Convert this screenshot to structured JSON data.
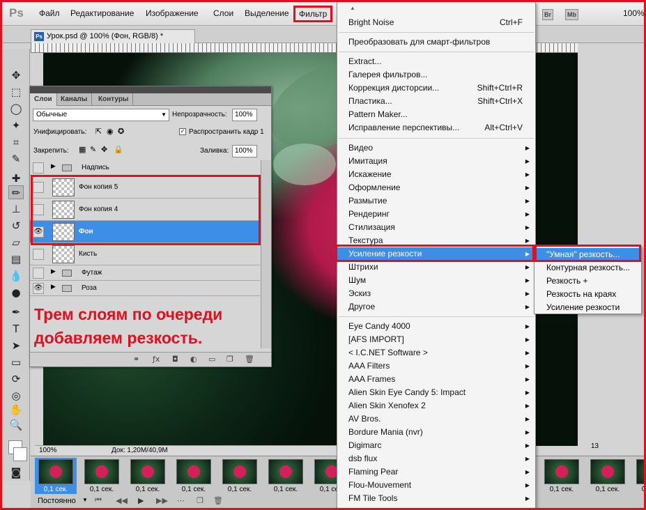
{
  "app": {
    "logo": "Ps"
  },
  "menubar": {
    "items": [
      "Файл",
      "Редактирование",
      "Изображение",
      "Слои",
      "Выделение",
      "Фильтр"
    ],
    "right": {
      "br": "Br",
      "mb": "Mb",
      "zoom": "100%"
    }
  },
  "document": {
    "tab_title": "Урок.psd @ 100% (Фон, RGB/8) *",
    "zoom": "100%",
    "doc_info": "Док: 1,20M/40,9M"
  },
  "layers_panel": {
    "tabs": [
      "Слои",
      "Каналы",
      "Контуры"
    ],
    "blend_mode": "Обычные",
    "opacity_label": "Непрозрачность:",
    "opacity_value": "100%",
    "unify_label": "Унифицировать:",
    "propagate_label": "Распространить кадр 1",
    "lock_label": "Закрепить:",
    "fill_label": "Заливка:",
    "fill_value": "100%",
    "layers": [
      {
        "name": "Надпись",
        "type": "group"
      },
      {
        "name": "Фон копия 5",
        "type": "layer"
      },
      {
        "name": "Фон копия 4",
        "type": "layer"
      },
      {
        "name": "Фон",
        "type": "layer",
        "selected": true
      },
      {
        "name": "Кисть",
        "type": "layer"
      },
      {
        "name": "Футаж",
        "type": "group"
      },
      {
        "name": "Роза",
        "type": "group"
      }
    ],
    "note_line1": "Трем слоям по очереди",
    "note_line2": "добавляем резкость."
  },
  "filter_menu": {
    "last_filter": "Bright Noise",
    "last_filter_shortcut": "Ctrl+F",
    "smart": "Преобразовать для смарт-фильтров",
    "group2": [
      {
        "label": "Extract...",
        "shortcut": ""
      },
      {
        "label": "Галерея фильтров...",
        "shortcut": ""
      },
      {
        "label": "Коррекция дисторсии...",
        "shortcut": "Shift+Ctrl+R"
      },
      {
        "label": "Пластика...",
        "shortcut": "Shift+Ctrl+X"
      },
      {
        "label": "Pattern Maker...",
        "shortcut": ""
      },
      {
        "label": "Исправление перспективы...",
        "shortcut": "Alt+Ctrl+V"
      }
    ],
    "group3": [
      "Видео",
      "Имитация",
      "Искажение",
      "Оформление",
      "Размытие",
      "Рендеринг",
      "Стилизация",
      "Текстура",
      "Усиление резкости",
      "Штрихи",
      "Шум",
      "Эскиз",
      "Другое"
    ],
    "group4": [
      "Eye Candy 4000",
      "[AFS IMPORT]",
      "< I.C.NET Software >",
      "AAA Filters",
      "AAA Frames",
      "Alien Skin Eye Candy 5: Impact",
      "Alien Skin Xenofex 2",
      "AV Bros.",
      "Bordure Mania (nvr)",
      "Digimarc",
      "dsb flux",
      "Flaming Pear",
      "Flou-Mouvement",
      "FM Tile Tools"
    ]
  },
  "sharpen_submenu": [
    "\"Умная\" резкость...",
    "Контурная резкость...",
    "Резкость +",
    "Резкость на краях",
    "Усиление резкости"
  ],
  "animation": {
    "frames": [
      {
        "delay": "0,1 сек."
      },
      {
        "delay": "0,1 сек."
      },
      {
        "delay": "0,1 сек."
      },
      {
        "delay": "0,1 сек."
      },
      {
        "delay": "0,1 сек."
      },
      {
        "delay": "0,1 сек."
      },
      {
        "delay": "0,1 сек."
      },
      {
        "delay": "0,1 сек."
      },
      {
        "delay": "0,1 сек."
      },
      {
        "delay": "0,1 сек."
      },
      {
        "delay": "0,1 сек."
      },
      {
        "delay": "0,1 сек."
      },
      {
        "delay": "0,1 сек."
      },
      {
        "delay": "0,1 сек."
      }
    ],
    "frame_number": "13",
    "loop": "Постоянно"
  }
}
